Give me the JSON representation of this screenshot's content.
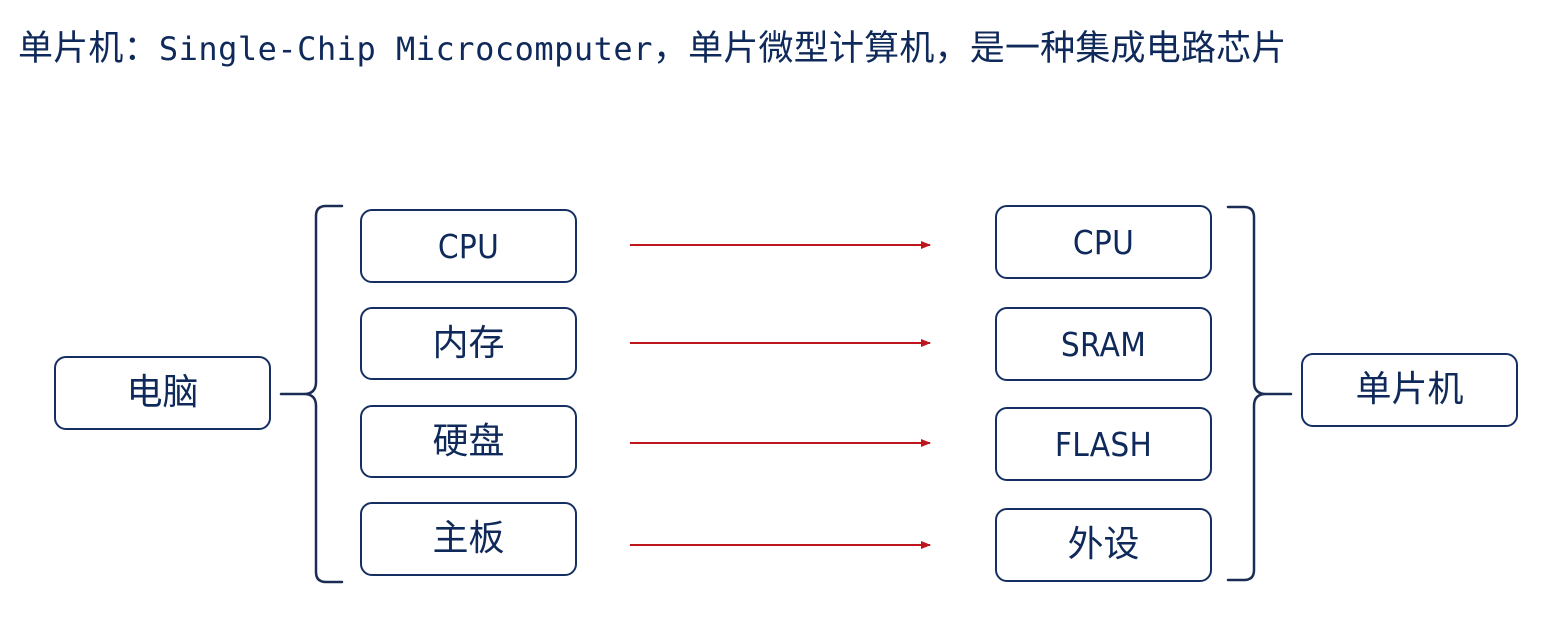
{
  "headline": {
    "prefix": "单片机：",
    "latin": "Single-Chip Microcomputer",
    "suffix": "，单片微型计算机，是一种集成电路芯片"
  },
  "computer": {
    "label": "电脑",
    "parts": [
      "CPU",
      "内存",
      "硬盘",
      "主板"
    ]
  },
  "mcu": {
    "label": "单片机",
    "parts": [
      "CPU",
      "SRAM",
      "FLASH",
      "外设"
    ]
  },
  "colors": {
    "text": "#0f2a5a",
    "border": "#162f62",
    "arrow": "#c0141c"
  }
}
